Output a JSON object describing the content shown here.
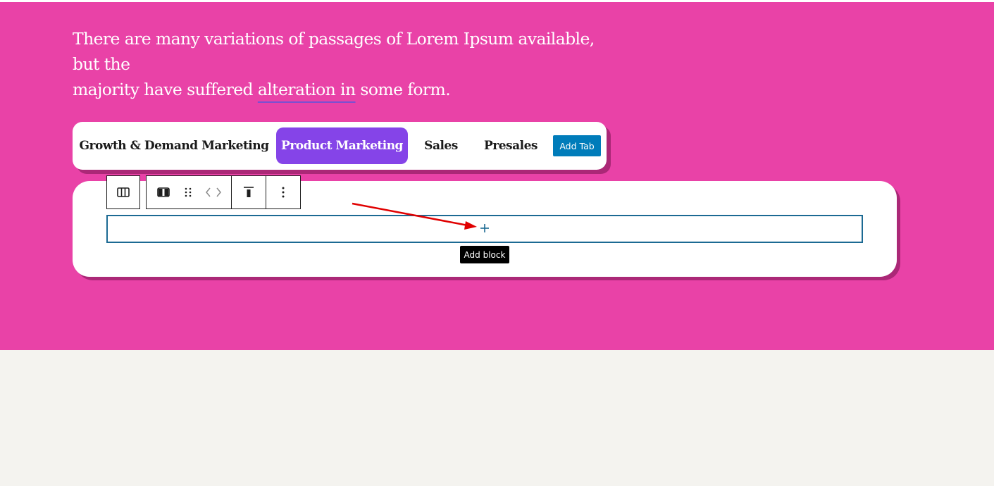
{
  "intro": {
    "line1": "There are many variations of passages of Lorem Ipsum available, but the",
    "line2_before": "majority have suffered ",
    "line2_highlight": "alteration in",
    "line2_after": " some form."
  },
  "tabs": [
    {
      "label": "Growth & Demand Marketing",
      "active": false
    },
    {
      "label": "Product Marketing",
      "active": true
    },
    {
      "label": "Sales",
      "active": false
    },
    {
      "label": "Presales",
      "active": false
    }
  ],
  "add_tab_label": "Add Tab",
  "block_toolbar": {
    "buttons": [
      "columns-icon",
      "column-icon",
      "drag-handle-icon",
      "move-arrows-icon",
      "align-top-icon",
      "more-options-icon"
    ]
  },
  "appender": {
    "tooltip": "Add block",
    "icon": "plus-icon"
  },
  "colors": {
    "hero_background": "#e942a7",
    "active_tab": "#8544e8",
    "add_tab_button": "#007cba",
    "appender_border": "#1c6a93",
    "annotation_arrow": "#e00000",
    "page_background": "#f4f3ef"
  }
}
